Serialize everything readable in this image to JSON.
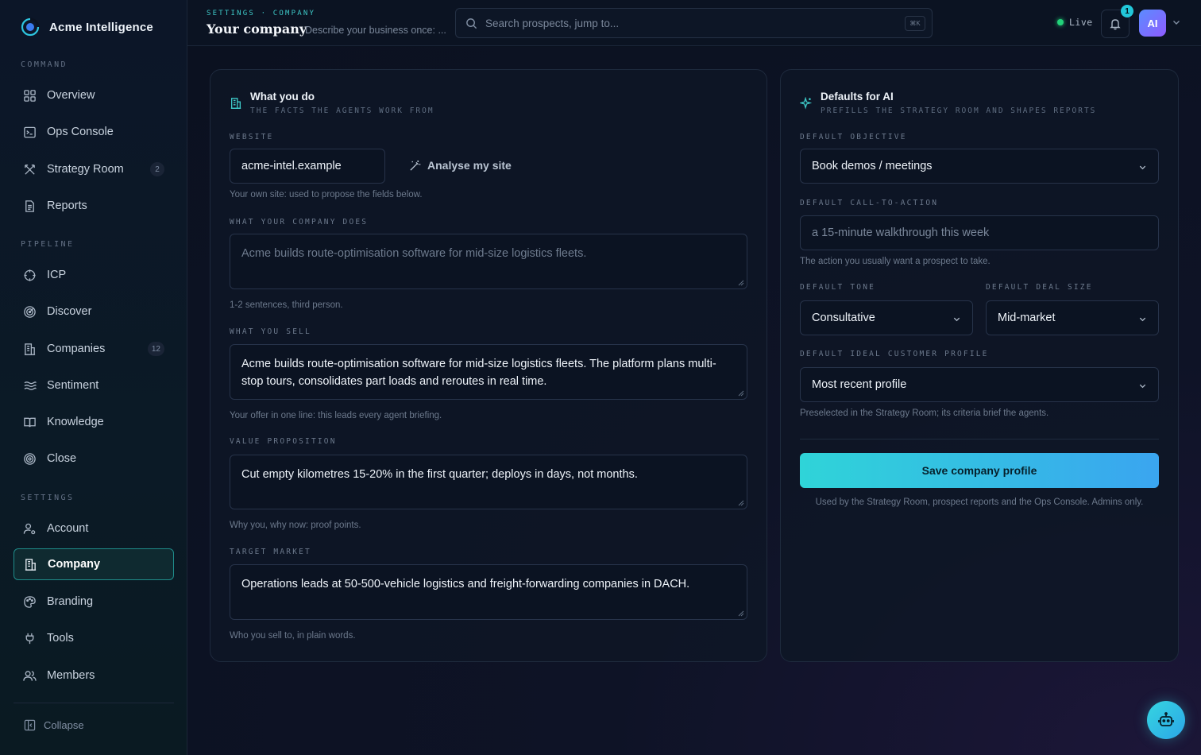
{
  "app": {
    "name": "Acme Intelligence"
  },
  "sidebar": {
    "sections": [
      {
        "label": "COMMAND"
      },
      {
        "label": "PIPELINE"
      },
      {
        "label": "SETTINGS"
      }
    ],
    "items": [
      {
        "label": "Overview",
        "icon": "grid-icon"
      },
      {
        "label": "Ops Console",
        "icon": "terminal-icon"
      },
      {
        "label": "Strategy Room",
        "icon": "crossed-tools-icon",
        "badge": "2"
      },
      {
        "label": "Reports",
        "icon": "document-icon"
      },
      {
        "label": "ICP",
        "icon": "crosshair-icon"
      },
      {
        "label": "Discover",
        "icon": "radar-icon"
      },
      {
        "label": "Companies",
        "icon": "building-icon",
        "badge": "12"
      },
      {
        "label": "Sentiment",
        "icon": "waves-icon"
      },
      {
        "label": "Knowledge",
        "icon": "book-icon"
      },
      {
        "label": "Close",
        "icon": "target-icon"
      },
      {
        "label": "Account",
        "icon": "user-gear-icon"
      },
      {
        "label": "Company",
        "icon": "building-icon",
        "active": true
      },
      {
        "label": "Branding",
        "icon": "palette-icon"
      },
      {
        "label": "Tools",
        "icon": "plug-icon"
      },
      {
        "label": "Members",
        "icon": "users-icon"
      }
    ],
    "collapse_label": "Collapse"
  },
  "header": {
    "breadcrumb": "SETTINGS · COMPANY",
    "title": "Your company",
    "subtitle": "Describe your business once: ...",
    "search_placeholder": "Search prospects, jump to...",
    "search_shortcut": "⌘K",
    "live_label": "Live",
    "notification_count": "1",
    "avatar_initials": "AI"
  },
  "what_you_do": {
    "title": "What you do",
    "subtitle": "THE FACTS THE AGENTS WORK FROM",
    "website_label": "WEBSITE",
    "website_value": "acme-intel.example",
    "analyse_label": "Analyse my site",
    "website_help": "Your own site: used to propose the fields below.",
    "company_does_label": "WHAT YOUR COMPANY DOES",
    "company_does_placeholder": "Acme builds route-optimisation software for mid-size logistics fleets.",
    "company_does_help": "1-2 sentences, third person.",
    "what_you_sell_label": "WHAT YOU SELL",
    "what_you_sell_value": "Acme builds route-optimisation software for mid-size logistics fleets. The platform plans multi-stop tours, consolidates part loads and reroutes in real time.",
    "what_you_sell_help": "Your offer in one line: this leads every agent briefing.",
    "value_prop_label": "VALUE PROPOSITION",
    "value_prop_value": "Cut empty kilometres 15-20% in the first quarter; deploys in days, not months.",
    "value_prop_help": "Why you, why now: proof points.",
    "target_market_label": "TARGET MARKET",
    "target_market_value": "Operations leads at 50-500-vehicle logistics and freight-forwarding companies in DACH.",
    "target_market_help": "Who you sell to, in plain words."
  },
  "defaults_ai": {
    "title": "Defaults for AI",
    "subtitle": "PREFILLS THE STRATEGY ROOM AND SHAPES REPORTS",
    "objective_label": "DEFAULT OBJECTIVE",
    "objective_value": "Book demos / meetings",
    "cta_label": "DEFAULT CALL-TO-ACTION",
    "cta_placeholder": "a 15-minute walkthrough this week",
    "cta_help": "The action you usually want a prospect to take.",
    "tone_label": "DEFAULT TONE",
    "tone_value": "Consultative",
    "deal_size_label": "DEFAULT DEAL SIZE",
    "deal_size_value": "Mid-market",
    "icp_label": "DEFAULT IDEAL CUSTOMER PROFILE",
    "icp_value": "Most recent profile",
    "icp_help": "Preselected in the Strategy Room; its criteria brief the agents.",
    "save_label": "Save company profile",
    "save_note": "Used by the Strategy Room, prospect reports and the Ops Console. Admins only."
  },
  "colors": {
    "accent": "#2fd4d8",
    "active_border": "#1f8c8a",
    "live": "#22d37a"
  }
}
